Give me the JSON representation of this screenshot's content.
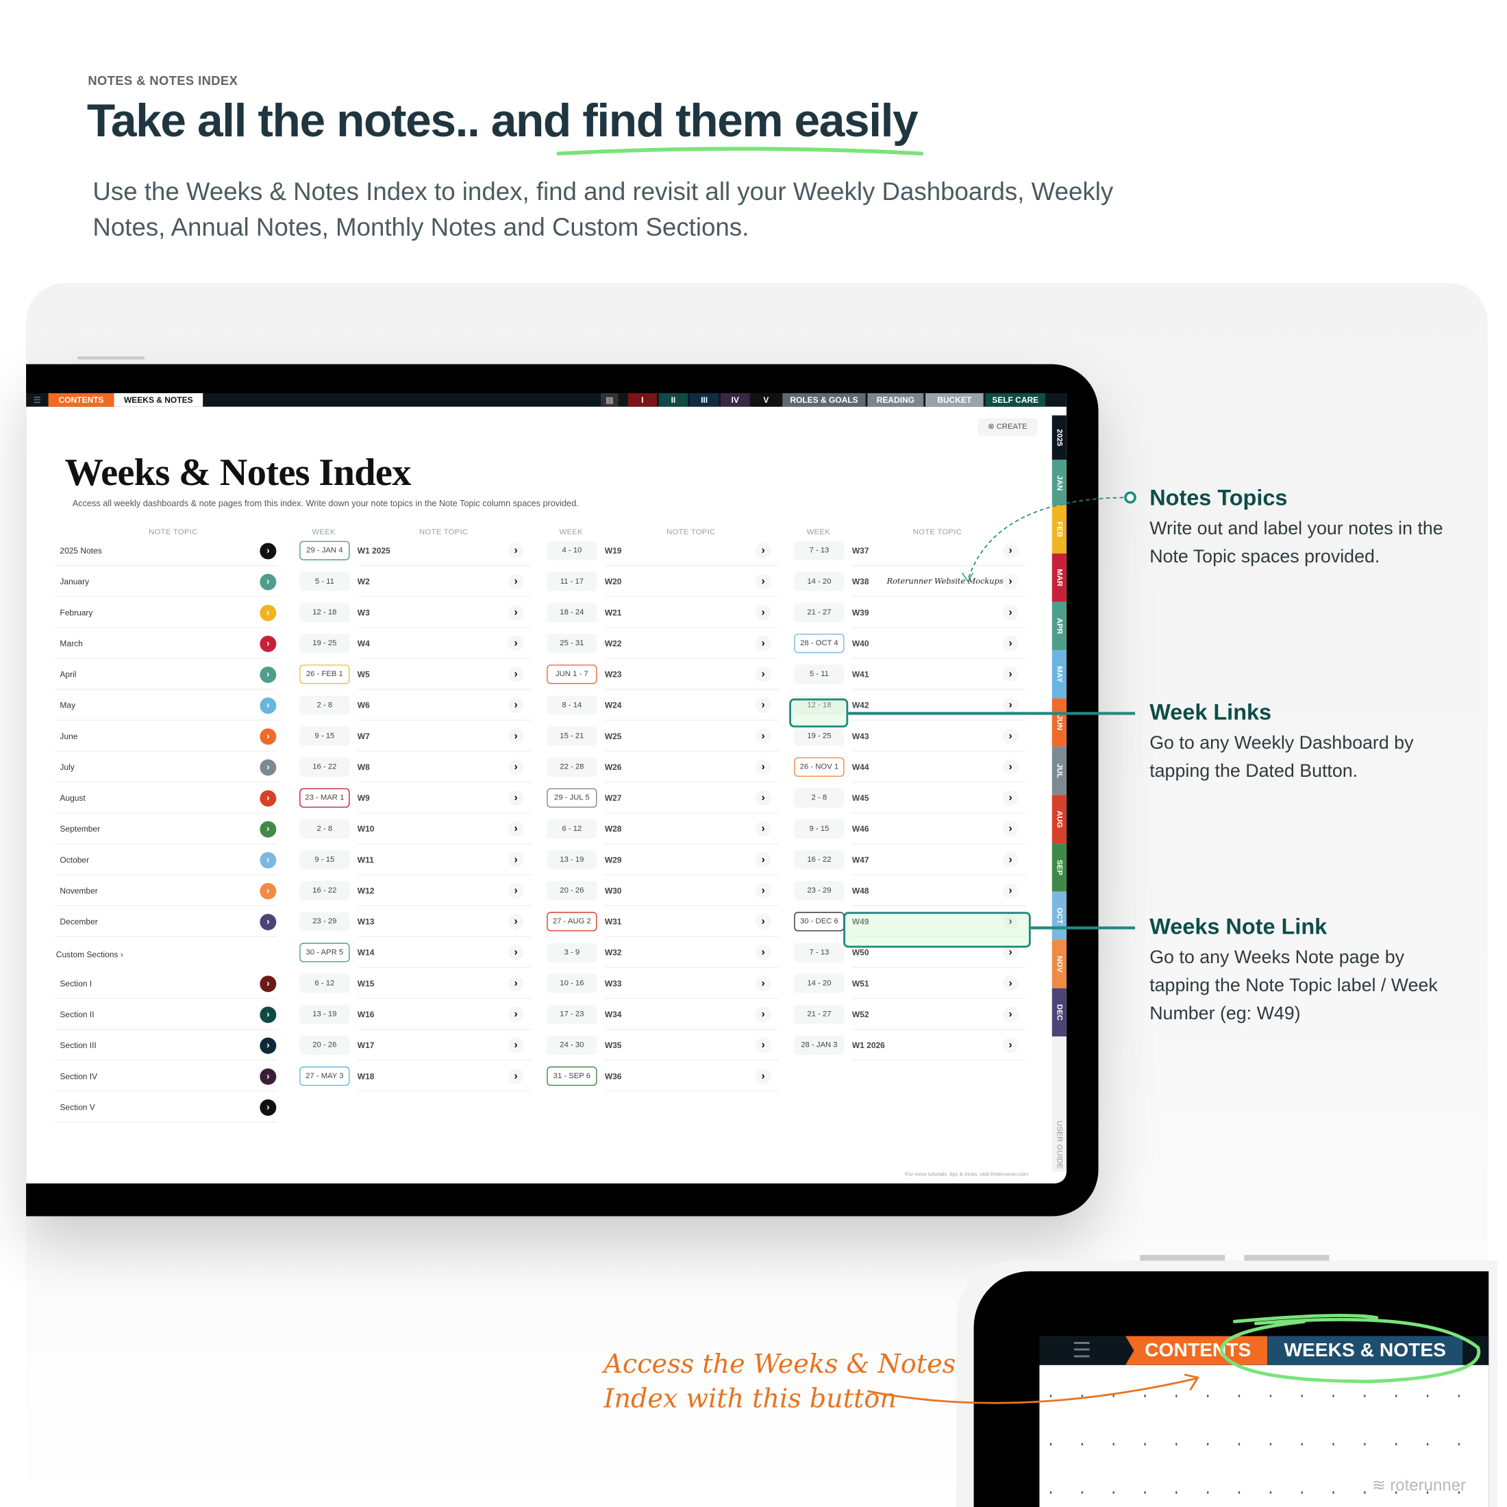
{
  "header": {
    "eyebrow": "NOTES & NOTES INDEX",
    "title": "Take all the notes.. and find them easily",
    "subtitle": "Use the Weeks & Notes Index to index, find and revisit all your Weekly Dashboards, Weekly Notes, Annual Notes, Monthly Notes and Custom Sections."
  },
  "topbar": {
    "tabs_left": [
      {
        "label": "CONTENTS",
        "color": "#f26b21"
      },
      {
        "label": "WEEKS & NOTES",
        "color": "#ffffff"
      }
    ],
    "tabs_right": [
      {
        "label": "I",
        "color": "#7a1418"
      },
      {
        "label": "II",
        "color": "#0f4a44"
      },
      {
        "label": "III",
        "color": "#0f2d40"
      },
      {
        "label": "IV",
        "color": "#3a2645"
      },
      {
        "label": "V",
        "color": "#111111"
      },
      {
        "label": "ROLES & GOALS",
        "color": "#5e6a70"
      },
      {
        "label": "READING",
        "color": "#7c878c"
      },
      {
        "label": "BUCKET",
        "color": "#9aa3a7"
      },
      {
        "label": "SELF CARE",
        "color": "#0e4e44"
      }
    ]
  },
  "page": {
    "title": "Weeks & Notes Index",
    "description": "Access all weekly dashboards & note pages from this index. Write down your note topics in the Note Topic column spaces provided.",
    "create_label": "CREATE",
    "col_note_topic": "NOTE TOPIC",
    "col_week": "WEEK",
    "footer": "For more tutorials, tips & tricks, visit Roterunner.com",
    "handwritten_note": "Roterunner Website Mockups"
  },
  "notes": [
    {
      "label": "2025 Notes",
      "color": "#111111"
    },
    {
      "label": "January",
      "color": "#4f9e8c"
    },
    {
      "label": "February",
      "color": "#f0b323"
    },
    {
      "label": "March",
      "color": "#c8203a"
    },
    {
      "label": "April",
      "color": "#4f9e8c"
    },
    {
      "label": "May",
      "color": "#6ab4e0"
    },
    {
      "label": "June",
      "color": "#f06a2b"
    },
    {
      "label": "July",
      "color": "#7c8a93"
    },
    {
      "label": "August",
      "color": "#d6412c"
    },
    {
      "label": "September",
      "color": "#3f8a48"
    },
    {
      "label": "October",
      "color": "#7ab8e0"
    },
    {
      "label": "November",
      "color": "#f08a45"
    },
    {
      "label": "December",
      "color": "#4a4575"
    }
  ],
  "custom_sections_label": "Custom Sections ›",
  "sections": [
    {
      "label": "Section I",
      "color": "#6b1a1a"
    },
    {
      "label": "Section II",
      "color": "#0f4a44"
    },
    {
      "label": "Section III",
      "color": "#0e2a3a"
    },
    {
      "label": "Section IV",
      "color": "#3a1f3a"
    },
    {
      "label": "Section V",
      "color": "#111111"
    }
  ],
  "week_columns": [
    [
      {
        "d": "29 - JAN 4",
        "w": "W1  2025",
        "b": "#4f9e8c"
      },
      {
        "d": "5 - 11",
        "w": "W2"
      },
      {
        "d": "12 - 18",
        "w": "W3"
      },
      {
        "d": "19 - 25",
        "w": "W4"
      },
      {
        "d": "26 - FEB 1",
        "w": "W5",
        "b": "#f0c040"
      },
      {
        "d": "2 - 8",
        "w": "W6"
      },
      {
        "d": "9 - 15",
        "w": "W7"
      },
      {
        "d": "16 - 22",
        "w": "W8"
      },
      {
        "d": "23 - MAR 1",
        "w": "W9",
        "b": "#c8203a"
      },
      {
        "d": "2 - 8",
        "w": "W10"
      },
      {
        "d": "9 - 15",
        "w": "W11"
      },
      {
        "d": "16 - 22",
        "w": "W12"
      },
      {
        "d": "23 - 29",
        "w": "W13"
      },
      {
        "d": "30 - APR 5",
        "w": "W14",
        "b": "#4f9e8c"
      },
      {
        "d": "6 - 12",
        "w": "W15"
      },
      {
        "d": "13 - 19",
        "w": "W16"
      },
      {
        "d": "20 - 26",
        "w": "W17"
      },
      {
        "d": "27 - MAY 3",
        "w": "W18",
        "b": "#6ab4e0"
      }
    ],
    [
      {
        "d": "4 - 10",
        "w": "W19"
      },
      {
        "d": "11 - 17",
        "w": "W20"
      },
      {
        "d": "18 - 24",
        "w": "W21"
      },
      {
        "d": "25 - 31",
        "w": "W22"
      },
      {
        "d": "JUN 1 - 7",
        "w": "W23",
        "b": "#f06a2b"
      },
      {
        "d": "8 - 14",
        "w": "W24"
      },
      {
        "d": "15 - 21",
        "w": "W25"
      },
      {
        "d": "22 - 28",
        "w": "W26"
      },
      {
        "d": "29 - JUL 5",
        "w": "W27",
        "b": "#7c8a93"
      },
      {
        "d": "6 - 12",
        "w": "W28"
      },
      {
        "d": "13 - 19",
        "w": "W29"
      },
      {
        "d": "20 - 26",
        "w": "W30"
      },
      {
        "d": "27 - AUG 2",
        "w": "W31",
        "b": "#d6412c"
      },
      {
        "d": "3 - 9",
        "w": "W32"
      },
      {
        "d": "10 - 16",
        "w": "W33"
      },
      {
        "d": "17 - 23",
        "w": "W34"
      },
      {
        "d": "24 - 30",
        "w": "W35"
      },
      {
        "d": "31 - SEP 6",
        "w": "W36",
        "b": "#3f8a48"
      }
    ],
    [
      {
        "d": "7 - 13",
        "w": "W37"
      },
      {
        "d": "14 - 20",
        "w": "W38"
      },
      {
        "d": "21 - 27",
        "w": "W39"
      },
      {
        "d": "28 - OCT 4",
        "w": "W40",
        "b": "#7ab8e0"
      },
      {
        "d": "5 - 11",
        "w": "W41"
      },
      {
        "d": "12 - 18",
        "w": "W42"
      },
      {
        "d": "19 - 25",
        "w": "W43"
      },
      {
        "d": "26 - NOV 1",
        "w": "W44",
        "b": "#f08a45"
      },
      {
        "d": "2 - 8",
        "w": "W45"
      },
      {
        "d": "9 - 15",
        "w": "W46"
      },
      {
        "d": "16 - 22",
        "w": "W47"
      },
      {
        "d": "23 - 29",
        "w": "W48"
      },
      {
        "d": "30 - DEC 6",
        "w": "W49",
        "b": "#333333"
      },
      {
        "d": "7 - 13",
        "w": "W50"
      },
      {
        "d": "14 - 20",
        "w": "W51"
      },
      {
        "d": "21 - 27",
        "w": "W52"
      },
      {
        "d": "28 - JAN 3",
        "w": "W1  2026"
      }
    ]
  ],
  "side_tabs": [
    {
      "label": "2025",
      "color": "#0c171d"
    },
    {
      "label": "JAN",
      "color": "#4f9e8c"
    },
    {
      "label": "FEB",
      "color": "#f0b323"
    },
    {
      "label": "MAR",
      "color": "#c8203a"
    },
    {
      "label": "APR",
      "color": "#4f9e8c"
    },
    {
      "label": "MAY",
      "color": "#6ab4e0"
    },
    {
      "label": "JUN",
      "color": "#f06a2b"
    },
    {
      "label": "JUL",
      "color": "#7c8a93"
    },
    {
      "label": "AUG",
      "color": "#d6412c"
    },
    {
      "label": "SEP",
      "color": "#3f8a48"
    },
    {
      "label": "OCT",
      "color": "#7ab8e0"
    },
    {
      "label": "NOV",
      "color": "#f08a45"
    },
    {
      "label": "DEC",
      "color": "#4a4575"
    }
  ],
  "user_guide": "USER GUIDE",
  "callouts": [
    {
      "title": "Notes Topics",
      "body": "Write out and label your notes in the Note Topic spaces provided."
    },
    {
      "title": "Week Links",
      "body": "Go to any Weekly Dashboard by tapping the Dated Button."
    },
    {
      "title": "Weeks Note Link",
      "body": "Go to any Weeks Note page by tapping the Note Topic label / Week Number (eg: W49)"
    }
  ],
  "zoom_inset": {
    "contents": "CONTENTS",
    "weeks_notes": "WEEKS & NOTES",
    "handwritten_line1": "Access the Weeks & Notes",
    "handwritten_line2": "Index with this button"
  },
  "brand": "roterunner",
  "colors": {
    "accent_green": "#7be37b",
    "teal": "#1f8a80",
    "orange": "#e8731e",
    "navy_tab": "#1d4e6e"
  }
}
